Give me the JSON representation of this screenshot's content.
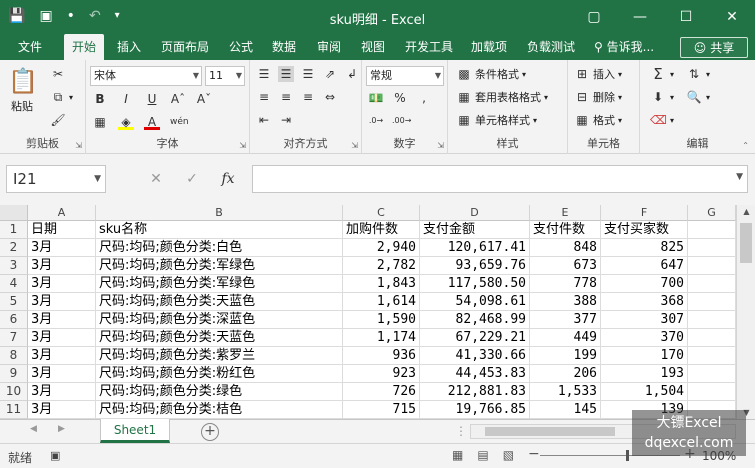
{
  "window": {
    "title": "sku明细 - Excel",
    "accent": "#217346"
  },
  "tabs": [
    {
      "label": "文件"
    },
    {
      "label": "开始"
    },
    {
      "label": "插入"
    },
    {
      "label": "页面布局"
    },
    {
      "label": "公式"
    },
    {
      "label": "数据"
    },
    {
      "label": "审阅"
    },
    {
      "label": "视图"
    },
    {
      "label": "开发工具"
    },
    {
      "label": "加载项"
    },
    {
      "label": "负载测试"
    }
  ],
  "tell_me": "告诉我...",
  "share": "共享",
  "ribbon": {
    "clipboard": {
      "label": "剪贴板",
      "paste": "粘贴"
    },
    "font": {
      "label": "字体",
      "name": "宋体",
      "size": "11"
    },
    "alignment": {
      "label": "对齐方式"
    },
    "number": {
      "label": "数字",
      "format": "常规"
    },
    "styles": {
      "label": "样式",
      "conditional": "条件格式",
      "table": "套用表格格式",
      "cell": "单元格样式"
    },
    "cells": {
      "label": "单元格",
      "insert": "插入",
      "delete": "删除",
      "format": "格式"
    },
    "editing": {
      "label": "编辑"
    }
  },
  "formula_bar": {
    "name_box": "I21",
    "formula": ""
  },
  "columns": [
    "A",
    "B",
    "C",
    "D",
    "E",
    "F",
    "G"
  ],
  "rows": [
    {
      "n": "1",
      "a": "日期",
      "b": "sku名称",
      "c": "加购件数",
      "d": "支付金额",
      "e": "支付件数",
      "f": "支付买家数"
    },
    {
      "n": "2",
      "a": "3月",
      "b": "尺码:均码;颜色分类:白色",
      "c": "2,940",
      "d": "120,617.41",
      "e": "848",
      "f": "825"
    },
    {
      "n": "3",
      "a": "3月",
      "b": "尺码:均码;颜色分类:军绿色",
      "c": "2,782",
      "d": "93,659.76",
      "e": "673",
      "f": "647"
    },
    {
      "n": "4",
      "a": "3月",
      "b": "尺码:均码;颜色分类:军绿色",
      "c": "1,843",
      "d": "117,580.50",
      "e": "778",
      "f": "700"
    },
    {
      "n": "5",
      "a": "3月",
      "b": "尺码:均码;颜色分类:天蓝色",
      "c": "1,614",
      "d": "54,098.61",
      "e": "388",
      "f": "368"
    },
    {
      "n": "6",
      "a": "3月",
      "b": "尺码:均码;颜色分类:深蓝色",
      "c": "1,590",
      "d": "82,468.99",
      "e": "377",
      "f": "307"
    },
    {
      "n": "7",
      "a": "3月",
      "b": "尺码:均码;颜色分类:天蓝色",
      "c": "1,174",
      "d": "67,229.21",
      "e": "449",
      "f": "370"
    },
    {
      "n": "8",
      "a": "3月",
      "b": "尺码:均码;颜色分类:紫罗兰",
      "c": "936",
      "d": "41,330.66",
      "e": "199",
      "f": "170"
    },
    {
      "n": "9",
      "a": "3月",
      "b": "尺码:均码;颜色分类:粉红色",
      "c": "923",
      "d": "44,453.83",
      "e": "206",
      "f": "193"
    },
    {
      "n": "10",
      "a": "3月",
      "b": "尺码:均码;颜色分类:绿色",
      "c": "726",
      "d": "212,881.83",
      "e": "1,533",
      "f": "1,504"
    },
    {
      "n": "11",
      "a": "3月",
      "b": "尺码:均码;颜色分类:桔色",
      "c": "715",
      "d": "19,766.85",
      "e": "145",
      "f": "139"
    }
  ],
  "sheet_tab": "Sheet1",
  "status": {
    "ready": "就绪",
    "zoom": "100%"
  },
  "watermark": {
    "line1": "大镖Excel",
    "line2": "dqexcel.com"
  }
}
